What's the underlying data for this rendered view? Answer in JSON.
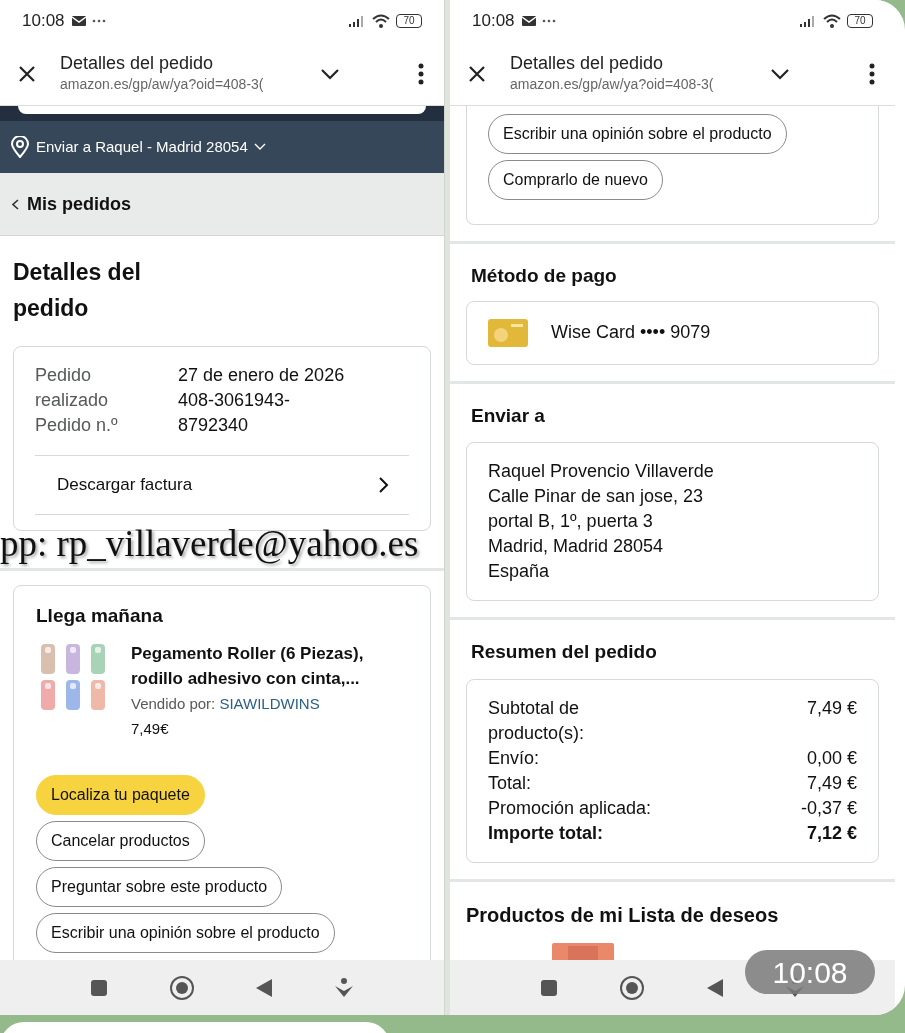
{
  "left_screen": {
    "status_bar": {
      "time": "10:08",
      "battery": "70"
    },
    "browser": {
      "title": "Detalles del pedido",
      "url": "amazon.es/gp/aw/ya?oid=408-3("
    },
    "delivery_bar": "Enviar a Raquel - Madrid 28054",
    "back_link": "Mis pedidos",
    "heading": "Detalles del pedido",
    "order_info": {
      "labels": [
        "Pedido realizado",
        "Pedido n.º"
      ],
      "values": [
        "27 de enero de 2026",
        "408-3061943-8792340"
      ]
    },
    "invoice_link": "Descargar factura",
    "shipment": {
      "heading": "Llega mañana",
      "product_title": "Pegamento Roller (6 Piezas), rodillo adhesivo con cinta,...",
      "seller_label": "Vendido por:",
      "seller": "SIAWILDWINS",
      "price": "7,49€",
      "buttons": [
        {
          "label": "Localiza tu paquete",
          "kind": "primary"
        },
        {
          "label": "Cancelar productos",
          "kind": "outline"
        },
        {
          "label": "Preguntar sobre este producto",
          "kind": "outline"
        },
        {
          "label": "Escribir una opinión sobre el producto",
          "kind": "outline"
        }
      ]
    }
  },
  "overlay_text": "pp: rp_villaverde@yahoo.es",
  "right_screen": {
    "status_bar": {
      "time": "10:08",
      "battery": "70"
    },
    "browser": {
      "title": "Detalles del pedido",
      "url": "amazon.es/gp/aw/ya?oid=408-3("
    },
    "buttons": [
      {
        "label": "Escribir una opinión sobre el producto",
        "kind": "outline"
      },
      {
        "label": "Comprarlo de nuevo",
        "kind": "outline"
      }
    ],
    "payment": {
      "heading": "Método de pago",
      "card": "Wise Card •••• 9079"
    },
    "shipping": {
      "heading": "Enviar a",
      "address": [
        "Raquel Provencio Villaverde",
        "Calle Pinar de san jose, 23",
        "portal B, 1º, puerta 3",
        "Madrid, Madrid 28054",
        "España"
      ]
    },
    "summary": {
      "heading": "Resumen del pedido",
      "rows": [
        {
          "label": "Subtotal de producto(s):",
          "value": "7,49 €",
          "bold": false
        },
        {
          "label": "Envío:",
          "value": "0,00 €",
          "bold": false
        },
        {
          "label": "Total:",
          "value": "7,49 €",
          "bold": false
        },
        {
          "label": "Promoción aplicada:",
          "value": "-0,37 €",
          "bold": false
        },
        {
          "label": "Importe total:",
          "value": "7,12 €",
          "bold": true
        }
      ]
    },
    "wishlist": {
      "heading": "Productos de mi Lista de deseos"
    }
  },
  "message_time": "10:08"
}
